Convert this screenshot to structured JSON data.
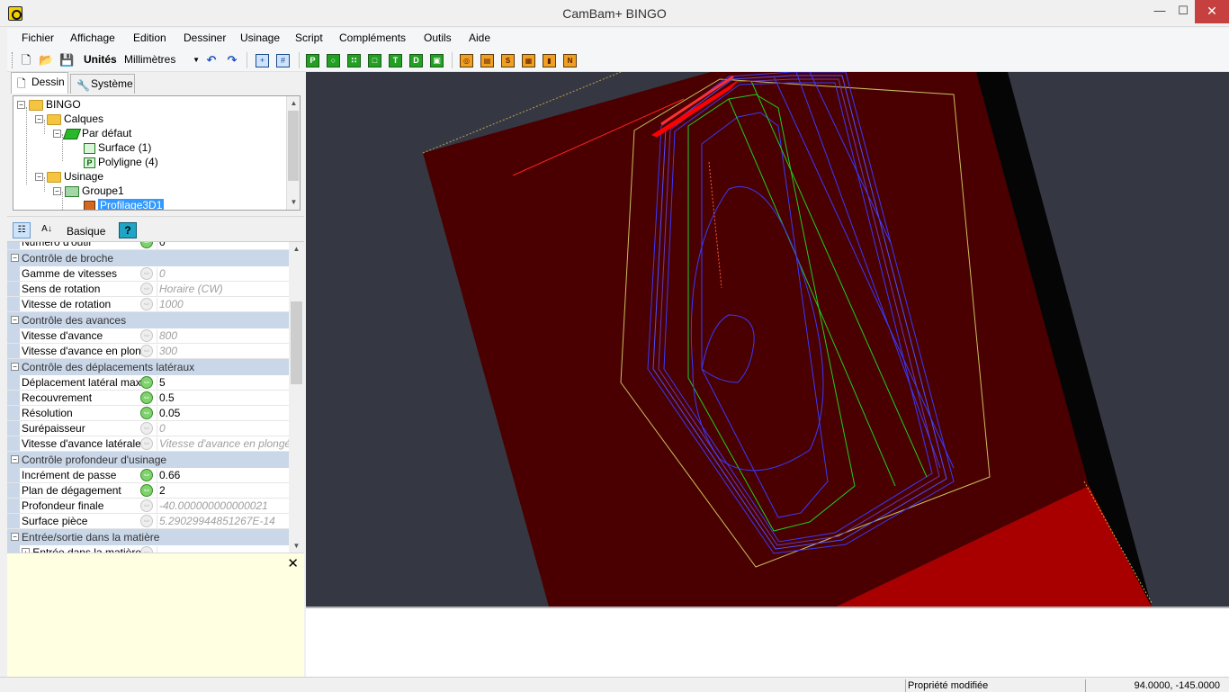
{
  "window": {
    "title": "CamBam+  BINGO",
    "minimize": "—",
    "maximize": "☐",
    "close": "✕"
  },
  "menu": [
    "Fichier",
    "Affichage",
    "Edition",
    "Dessiner",
    "Usinage",
    "Script",
    "Compléments",
    "Outils",
    "Aide"
  ],
  "toolbar": {
    "units_label": "Unités",
    "units_value": "Millimètres"
  },
  "tabs": [
    "Dessin",
    "Système"
  ],
  "tree": {
    "root": "BINGO",
    "calques": "Calques",
    "layer": "Par défaut",
    "surface": "Surface (1)",
    "polyline": "Polyligne (4)",
    "usinage": "Usinage",
    "group": "Groupe1",
    "mop": "Profilage3D1"
  },
  "prop_toolbar": {
    "basique": "Basique",
    "help": "?"
  },
  "properties": [
    {
      "type": "cut",
      "name": "Numéro d'outil",
      "value": "0"
    },
    {
      "type": "cat",
      "name": "Contrôle de broche"
    },
    {
      "type": "row",
      "name": "Gamme de vitesses",
      "value": "0",
      "auto": true
    },
    {
      "type": "row",
      "name": "Sens de rotation",
      "value": "Horaire (CW)",
      "auto": true
    },
    {
      "type": "row",
      "name": "Vitesse de rotation",
      "value": "1000",
      "auto": true
    },
    {
      "type": "cat",
      "name": "Contrôle des avances"
    },
    {
      "type": "row",
      "name": "Vitesse d'avance",
      "value": "800",
      "auto": true
    },
    {
      "type": "row",
      "name": "Vitesse d'avance en plongée",
      "value": "300",
      "auto": true
    },
    {
      "type": "cat",
      "name": "Contrôle des déplacements latéraux"
    },
    {
      "type": "row",
      "name": "Déplacement latéral maxi",
      "value": "5",
      "auto": false
    },
    {
      "type": "row",
      "name": "Recouvrement",
      "value": "0.5",
      "auto": false
    },
    {
      "type": "row",
      "name": "Résolution",
      "value": "0.05",
      "auto": false
    },
    {
      "type": "row",
      "name": "Surépaisseur",
      "value": "0",
      "auto": true
    },
    {
      "type": "row",
      "name": "Vitesse d'avance latérale",
      "value": "Vitesse d'avance en plongée",
      "auto": true
    },
    {
      "type": "cat",
      "name": "Contrôle profondeur d'usinage"
    },
    {
      "type": "row",
      "name": "Incrément de passe",
      "value": "0.66",
      "auto": false
    },
    {
      "type": "row",
      "name": "Plan de dégagement",
      "value": "2",
      "auto": false
    },
    {
      "type": "row",
      "name": "Profondeur finale",
      "value": "-40.000000000000021",
      "auto": true
    },
    {
      "type": "row",
      "name": "Surface pièce",
      "value": "5.29029944851267E-14",
      "auto": true
    },
    {
      "type": "cat",
      "name": "Entrée/sortie dans la matière"
    },
    {
      "type": "row",
      "name": "Entrée dans la matière",
      "value": "",
      "auto": true,
      "expand": true
    }
  ],
  "status": {
    "message": "Propriété modifiée",
    "coords": "94.0000, -145.0000"
  },
  "colors": {
    "stock": "#4a0000",
    "viewport_bg": "#353843",
    "toolpath_blue": "#3a3aff",
    "toolpath_green": "#22cc22"
  }
}
